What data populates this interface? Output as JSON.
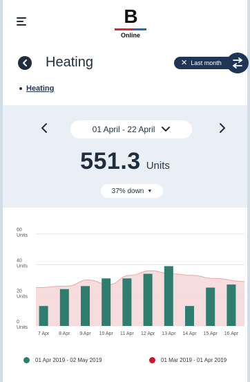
{
  "header": {
    "logo_letter": "B",
    "logo_sub": "Online"
  },
  "title_row": {
    "title": "Heating",
    "filter_label": "Last month"
  },
  "breadcrumb": {
    "label": "Heating"
  },
  "summary": {
    "date_range": "01 April - 22 April",
    "total_value": "551.3",
    "total_unit": "Units",
    "change_text": "37% down"
  },
  "colors": {
    "navy": "#1f3556",
    "bar_green": "#2e7d6e",
    "area_pink": "#f6d6d8",
    "area_line": "#e9a6ab",
    "legend_red": "#c8182b"
  },
  "chart_data": {
    "type": "bar",
    "categories": [
      "7 Apr",
      "8 Apr",
      "9 Apr",
      "10 Apr",
      "11 Apr",
      "12 Apr",
      "13 Apr",
      "14 Apr",
      "15 Apr",
      "16 Apr"
    ],
    "y_tick_labels": [
      {
        "value": 60,
        "label": "60",
        "unit": "Units"
      },
      {
        "value": 40,
        "label": "40",
        "unit": "Units"
      },
      {
        "value": 20,
        "label": "20",
        "unit": "Units"
      },
      {
        "value": 0,
        "label": "0",
        "unit": "Units"
      }
    ],
    "ylim": [
      0,
      60
    ],
    "series": [
      {
        "name": "01 Apr 2019 - 02 May 2019",
        "type": "bar",
        "color": "#2e7d6e",
        "values": [
          13,
          24,
          26,
          31,
          31,
          34,
          39,
          13,
          25,
          27
        ]
      },
      {
        "name": "01 Mar 2019 - 01 Apr 2019",
        "type": "area",
        "color": "#c8182b",
        "values": [
          25,
          26,
          30,
          27,
          33,
          36,
          34,
          33,
          31,
          29
        ]
      }
    ]
  }
}
